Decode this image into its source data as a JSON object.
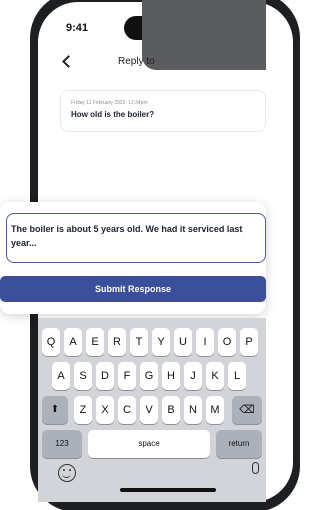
{
  "status_bar": {
    "time": "9:41"
  },
  "header": {
    "title": "Reply to",
    "back_icon": "chevron-left-icon"
  },
  "question": {
    "date": "Friday 11 February 2022, 12:34pm",
    "text": "How old is the boiler?"
  },
  "response": {
    "value": "The boiler is about 5 years old. We had it serviced last year...",
    "submit_label": "Submit Response"
  },
  "keyboard": {
    "row1": [
      "Q",
      "A",
      "E",
      "R",
      "T",
      "Y",
      "U",
      "I",
      "O",
      "P"
    ],
    "row2": [
      "A",
      "S",
      "D",
      "F",
      "G",
      "H",
      "J",
      "K",
      "L"
    ],
    "row3": [
      "Z",
      "X",
      "C",
      "V",
      "B",
      "N",
      "M"
    ],
    "shift": "⬆",
    "backspace": "⌫",
    "numbers": "123",
    "space": "space",
    "return": "return",
    "emoji_icon": "emoji-icon",
    "mic_icon": "microphone-icon"
  },
  "colors": {
    "accent": "#3b4f9b",
    "field_border": "#4d5b9c",
    "keyboard_bg": "#d2d4da"
  }
}
